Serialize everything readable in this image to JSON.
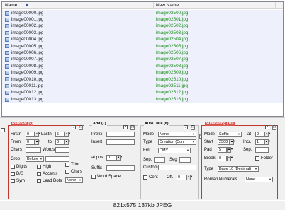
{
  "list": {
    "columns": {
      "name": "Name",
      "new_name": "New Name"
    },
    "rows": [
      {
        "name": "image00000.jpg",
        "new_name": "image02500.jpg"
      },
      {
        "name": "image00001.jpg",
        "new_name": "image02501.jpg"
      },
      {
        "name": "image00002.jpg",
        "new_name": "image02502.jpg"
      },
      {
        "name": "image00003.jpg",
        "new_name": "image02503.jpg"
      },
      {
        "name": "image00004.jpg",
        "new_name": "image02504.jpg"
      },
      {
        "name": "image00005.jpg",
        "new_name": "image02505.jpg"
      },
      {
        "name": "image00006.jpg",
        "new_name": "image02506.jpg"
      },
      {
        "name": "image00007.jpg",
        "new_name": "image02507.jpg"
      },
      {
        "name": "image00008.jpg",
        "new_name": "image02508.jpg"
      },
      {
        "name": "image00009.jpg",
        "new_name": "image02509.jpg"
      },
      {
        "name": "image00010.jpg",
        "new_name": "image02510.jpg"
      },
      {
        "name": "image00011.jpg",
        "new_name": "image02511.jpg"
      },
      {
        "name": "image00012.jpg",
        "new_name": "image02512.jpg"
      },
      {
        "name": "image00013.jpg",
        "new_name": "image02513.jpg"
      }
    ]
  },
  "remove": {
    "title": "Remove (5)",
    "firstn_label": "Firstn",
    "firstn_value": "0",
    "lastn_label": "Lastn",
    "lastn_value": "5",
    "from_label": "From",
    "from_value": "0",
    "to_label": "to",
    "to_value": "0",
    "chars_label": "Chars",
    "words_label": "Words",
    "crop_label": "Crop",
    "crop_value": "Before",
    "digits_label": "Digits",
    "high_label": "High",
    "trim_label": "Trim",
    "ds_label": "D/S",
    "accents_label": "Accents",
    "chars2_label": "Chars",
    "sym_label": "Sym",
    "leaddots_label": "Lead Dots",
    "leaddots_value": "None"
  },
  "add": {
    "title": "Add (7)",
    "prefix_label": "Prefix",
    "insert_label": "Insert",
    "atpos_label": "at pos.",
    "atpos_value": "0",
    "suffix_label": "Suffix",
    "wordspace_label": "Word Space"
  },
  "autodate": {
    "title": "Auto Date (8)",
    "mode_label": "Mode",
    "mode_value": "None",
    "type_label": "Type",
    "type_value": "Creation (Curr",
    "fmt_label": "Fmt",
    "fmt_value": "DMY",
    "sep_label": "Sep.",
    "seg_label": "Seg",
    "custom_label": "Custom",
    "cent_label": "Cent",
    "off_label": "Off.",
    "off_value": "0"
  },
  "numbering": {
    "title": "Numbering (10)",
    "mode_label": "Mode",
    "mode_value": "Suffix",
    "at_label": "at",
    "at_value": "0",
    "start_label": "Start",
    "start_value": "2500",
    "incr_label": "Incr.",
    "incr_value": "1",
    "pad_label": "Pad",
    "pad_value": "5",
    "sep_label": "Sep.",
    "break_label": "Break",
    "break_value": "0",
    "folder_label": "Folder",
    "type_label": "Type",
    "type_value": "Base 10 (Decimal)",
    "roman_label": "Roman Numerals",
    "roman_value": "None"
  },
  "caption": "821x575  137kb  JPEG"
}
